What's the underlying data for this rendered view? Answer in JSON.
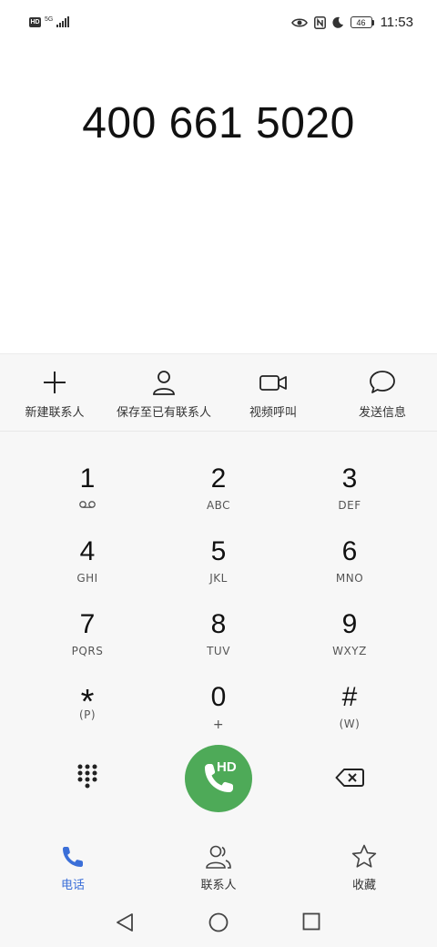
{
  "status_bar": {
    "hd": "HD",
    "network": "5G",
    "battery": "46",
    "time": "11:53"
  },
  "dialer": {
    "number": "400 661 5020"
  },
  "actions": [
    {
      "label": "新建联系人",
      "icon": "plus-icon"
    },
    {
      "label": "保存至已有联系人",
      "icon": "person-icon"
    },
    {
      "label": "视频呼叫",
      "icon": "video-camera-icon"
    },
    {
      "label": "发送信息",
      "icon": "message-bubble-icon"
    }
  ],
  "keypad": [
    {
      "digit": "1",
      "letters": ""
    },
    {
      "digit": "2",
      "letters": "ABC"
    },
    {
      "digit": "3",
      "letters": "DEF"
    },
    {
      "digit": "4",
      "letters": "GHI"
    },
    {
      "digit": "5",
      "letters": "JKL"
    },
    {
      "digit": "6",
      "letters": "MNO"
    },
    {
      "digit": "7",
      "letters": "PQRS"
    },
    {
      "digit": "8",
      "letters": "TUV"
    },
    {
      "digit": "9",
      "letters": "WXYZ"
    },
    {
      "digit": "*",
      "letters": "(P)"
    },
    {
      "digit": "0",
      "letters": "+"
    },
    {
      "digit": "#",
      "letters": "(W)"
    }
  ],
  "call_button": {
    "badge": "HD"
  },
  "tabs": [
    {
      "label": "电话",
      "active": true
    },
    {
      "label": "联系人",
      "active": false
    },
    {
      "label": "收藏",
      "active": false
    }
  ],
  "colors": {
    "accent": "#3b6fd8",
    "call_green": "#4eaa58",
    "panel_bg": "#f7f7f7"
  }
}
